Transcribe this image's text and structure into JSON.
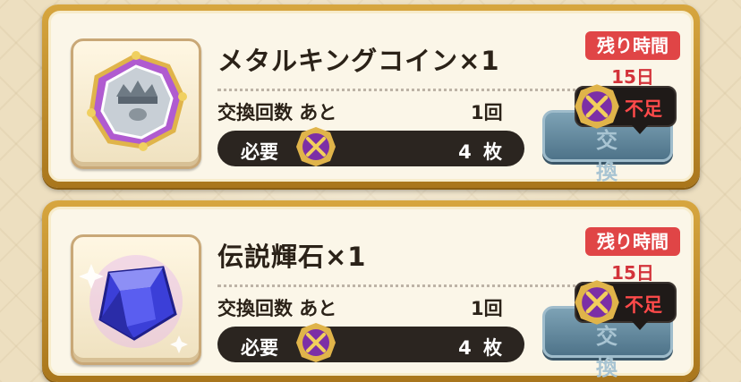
{
  "offers": [
    {
      "item_name": "メタルキングコイン×1",
      "exchange_label": "交換回数 あと",
      "exchange_remaining": "1回",
      "required_label": "必要",
      "required_count": "4 枚",
      "time_left_label": "残り時間",
      "time_left_value": "15日",
      "exchange_button": "交 換",
      "shortage_label": "不足",
      "icon": "metal-king-coin-icon"
    },
    {
      "item_name": "伝説輝石×1",
      "exchange_label": "交換回数 あと",
      "exchange_remaining": "1回",
      "required_label": "必要",
      "required_count": "4 枚",
      "time_left_label": "残り時間",
      "time_left_value": "15日",
      "exchange_button": "交 換",
      "shortage_label": "不足",
      "icon": "legend-gem-icon"
    }
  ],
  "colors": {
    "card_frame": "#d7a63f",
    "time_badge": "#e04546",
    "shortage_text": "#ff4a4a",
    "button_disabled": "#5d8297"
  }
}
